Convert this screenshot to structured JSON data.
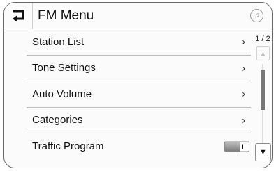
{
  "header": {
    "title": "FM Menu",
    "back_icon": "back-arrow-icon",
    "media_icon": "music-note-icon"
  },
  "menu": {
    "items": [
      {
        "label": "Station List",
        "indicator": "›"
      },
      {
        "label": "Tone Settings",
        "indicator": "›"
      },
      {
        "label": "Auto Volume",
        "indicator": "›"
      },
      {
        "label": "Categories",
        "indicator": "›"
      },
      {
        "label": "Traffic Program",
        "toggle": {
          "state": "on"
        }
      }
    ]
  },
  "scrollbar": {
    "page_indicator": "1 / 2",
    "up_glyph": "▲",
    "down_glyph": "▼",
    "position_fraction": 0.25,
    "visible_fraction": 0.5
  }
}
